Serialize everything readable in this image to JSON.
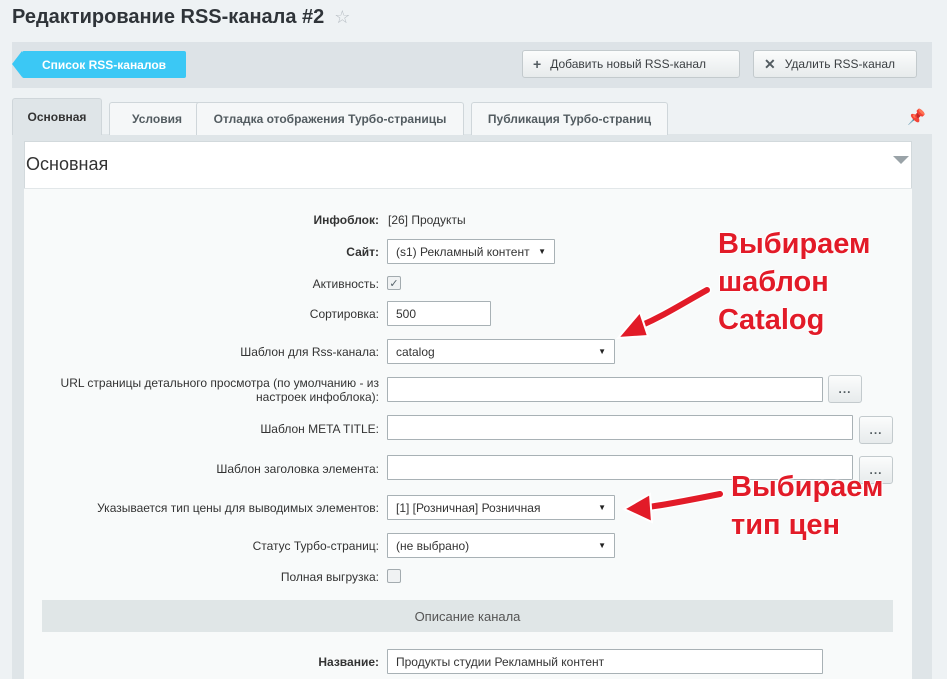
{
  "page": {
    "title": "Редактирование RSS-канала #2",
    "star_icon": "star-icon"
  },
  "toolbar": {
    "back_label": "Список RSS-каналов",
    "add_label": "Добавить новый RSS-канал",
    "delete_label": "Удалить RSS-канал"
  },
  "tabs": [
    {
      "label": "Основная",
      "active": true
    },
    {
      "label": "Условия"
    },
    {
      "label": "Отладка отображения Турбо-страницы"
    },
    {
      "label": "Публикация Турбо-страниц"
    }
  ],
  "section": {
    "title": "Основная"
  },
  "form": {
    "iblock": {
      "label": "Инфоблок:",
      "value": "[26] Продукты"
    },
    "site": {
      "label": "Сайт:",
      "value": "(s1) Рекламный контент"
    },
    "active": {
      "label": "Активность:",
      "checked": true
    },
    "sort": {
      "label": "Сортировка:",
      "value": "500"
    },
    "template": {
      "label": "Шаблон для Rss-канала:",
      "value": "catalog"
    },
    "detail_url": {
      "label_line1": "URL страницы детального просмотра (по умолчанию - из",
      "label_line2": "настроек инфоблока):",
      "value": ""
    },
    "meta_title": {
      "label": "Шаблон META TITLE:",
      "value": ""
    },
    "element_title": {
      "label": "Шаблон заголовка элемента:",
      "value": ""
    },
    "price_type": {
      "label": "Указывается тип цены для выводимых элементов:",
      "value": "[1] [Розничная] Розничная"
    },
    "turbo_status": {
      "label": "Статус Турбо-страниц:",
      "value": "(не выбрано)"
    },
    "full_export": {
      "label": "Полная выгрузка:",
      "checked": false
    },
    "dots_label": "...",
    "channel_section": "Описание канала",
    "name": {
      "label": "Название:",
      "value": "Продукты студии Рекламный контент"
    }
  },
  "annotations": {
    "template_line1": "Выбираем",
    "template_line2": "шаблон",
    "template_line3": "Catalog",
    "price_line1": "Выбираем",
    "price_line2": "тип цен"
  },
  "colors": {
    "accent": "#3bc8f5",
    "annotation": "#e21b28"
  }
}
